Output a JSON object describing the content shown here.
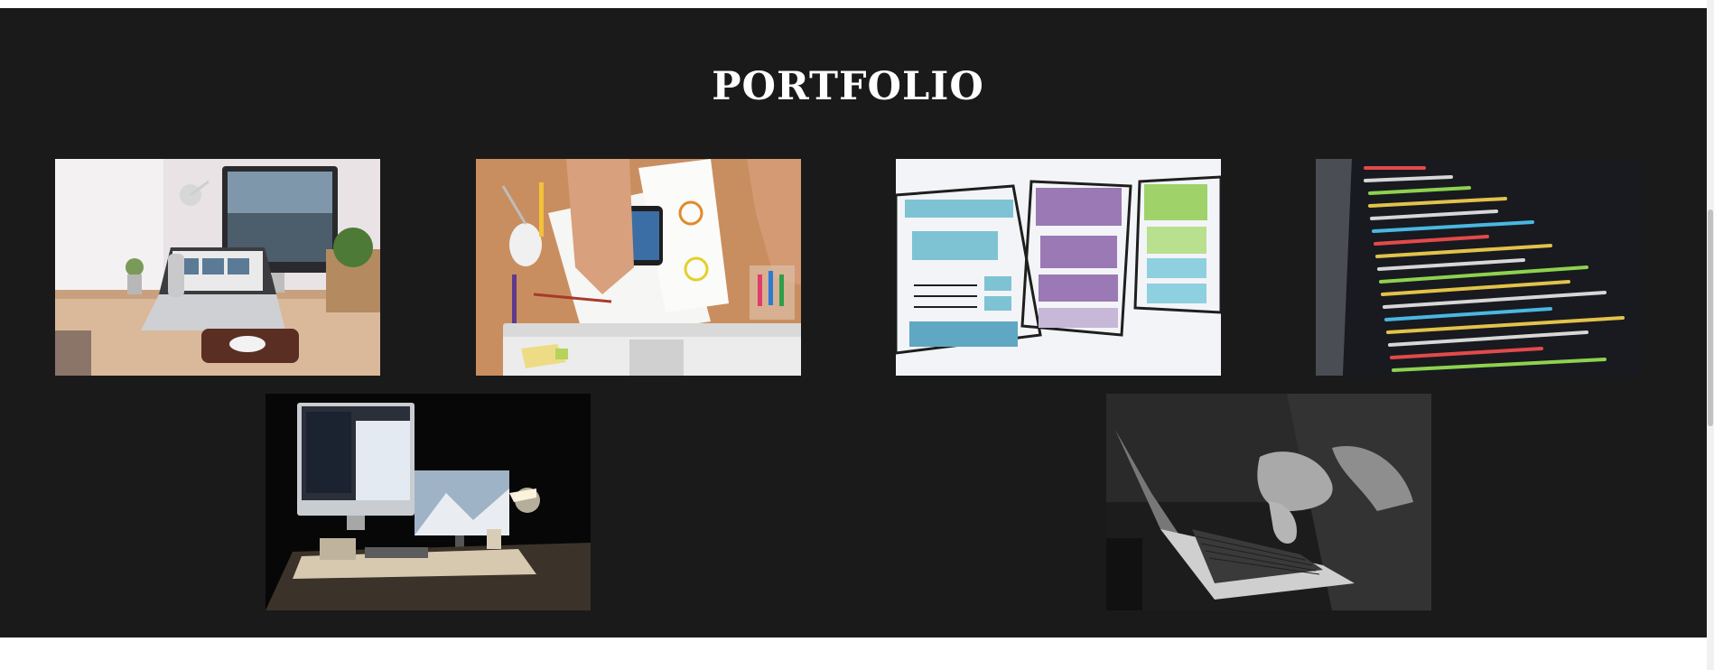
{
  "portfolio": {
    "title": "PORTFOLIO",
    "items": [
      {
        "image": "desk-workspace-laptop-monitor"
      },
      {
        "image": "hands-sketching-wireframes-phone"
      },
      {
        "image": "watercolor-wireframe-sketch"
      },
      {
        "image": "code-editor-screen"
      },
      {
        "image": "dark-desk-imac-lamp"
      },
      {
        "image": "hands-typing-laptop-bw"
      }
    ]
  },
  "colors": {
    "section_bg": "#1a1a1a",
    "title": "#ffffff"
  }
}
